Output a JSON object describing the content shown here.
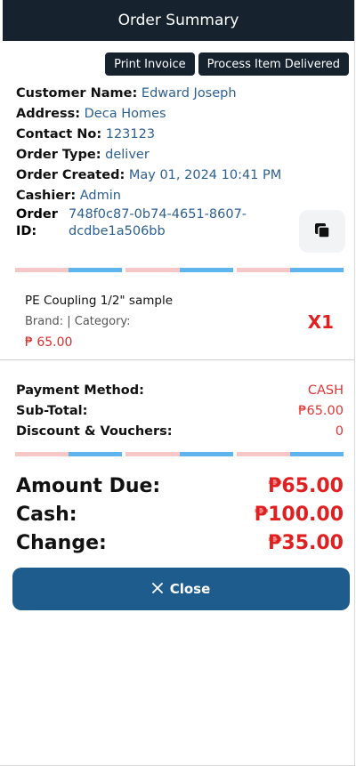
{
  "header": {
    "title": "Order Summary"
  },
  "actions": {
    "print_label": "Print Invoice",
    "process_label": "Process Item Delivered"
  },
  "customer": {
    "name_label": "Customer Name:",
    "name": "Edward Joseph",
    "address_label": "Address:",
    "address": "Deca Homes",
    "contact_label": "Contact No:",
    "contact": "123123",
    "type_label": "Order Type:",
    "type": "deliver",
    "created_label": "Order Created:",
    "created": "May 01, 2024 10:41 PM",
    "cashier_label": "Cashier:",
    "cashier": "Admin",
    "order_id_label": "Order ID:",
    "order_id": "748f0c87-0b74-4651-8607-dcdbe1a506bb"
  },
  "item": {
    "name": "PE Coupling 1/2\" sample",
    "meta": "Brand: | Category:",
    "price": "₱ 65.00",
    "qty": "X1"
  },
  "payment": {
    "method_label": "Payment Method:",
    "method": "CASH",
    "subtotal_label": "Sub-Total:",
    "subtotal": "₱65.00",
    "discount_label": "Discount & Vouchers:",
    "discount": "0"
  },
  "totals": {
    "amount_due_label": "Amount Due:",
    "amount_due": "₱65.00",
    "cash_label": "Cash:",
    "cash": "₱100.00",
    "change_label": "Change:",
    "change": "₱35.00"
  },
  "close": {
    "label": "Close"
  },
  "icons": {
    "copy": "copy-icon",
    "close": "close-icon"
  },
  "colors": {
    "header_bg": "#16222e",
    "accent_blue": "#1d5c8c",
    "value_blue": "#2c5f8f",
    "money_red": "#e02020"
  }
}
